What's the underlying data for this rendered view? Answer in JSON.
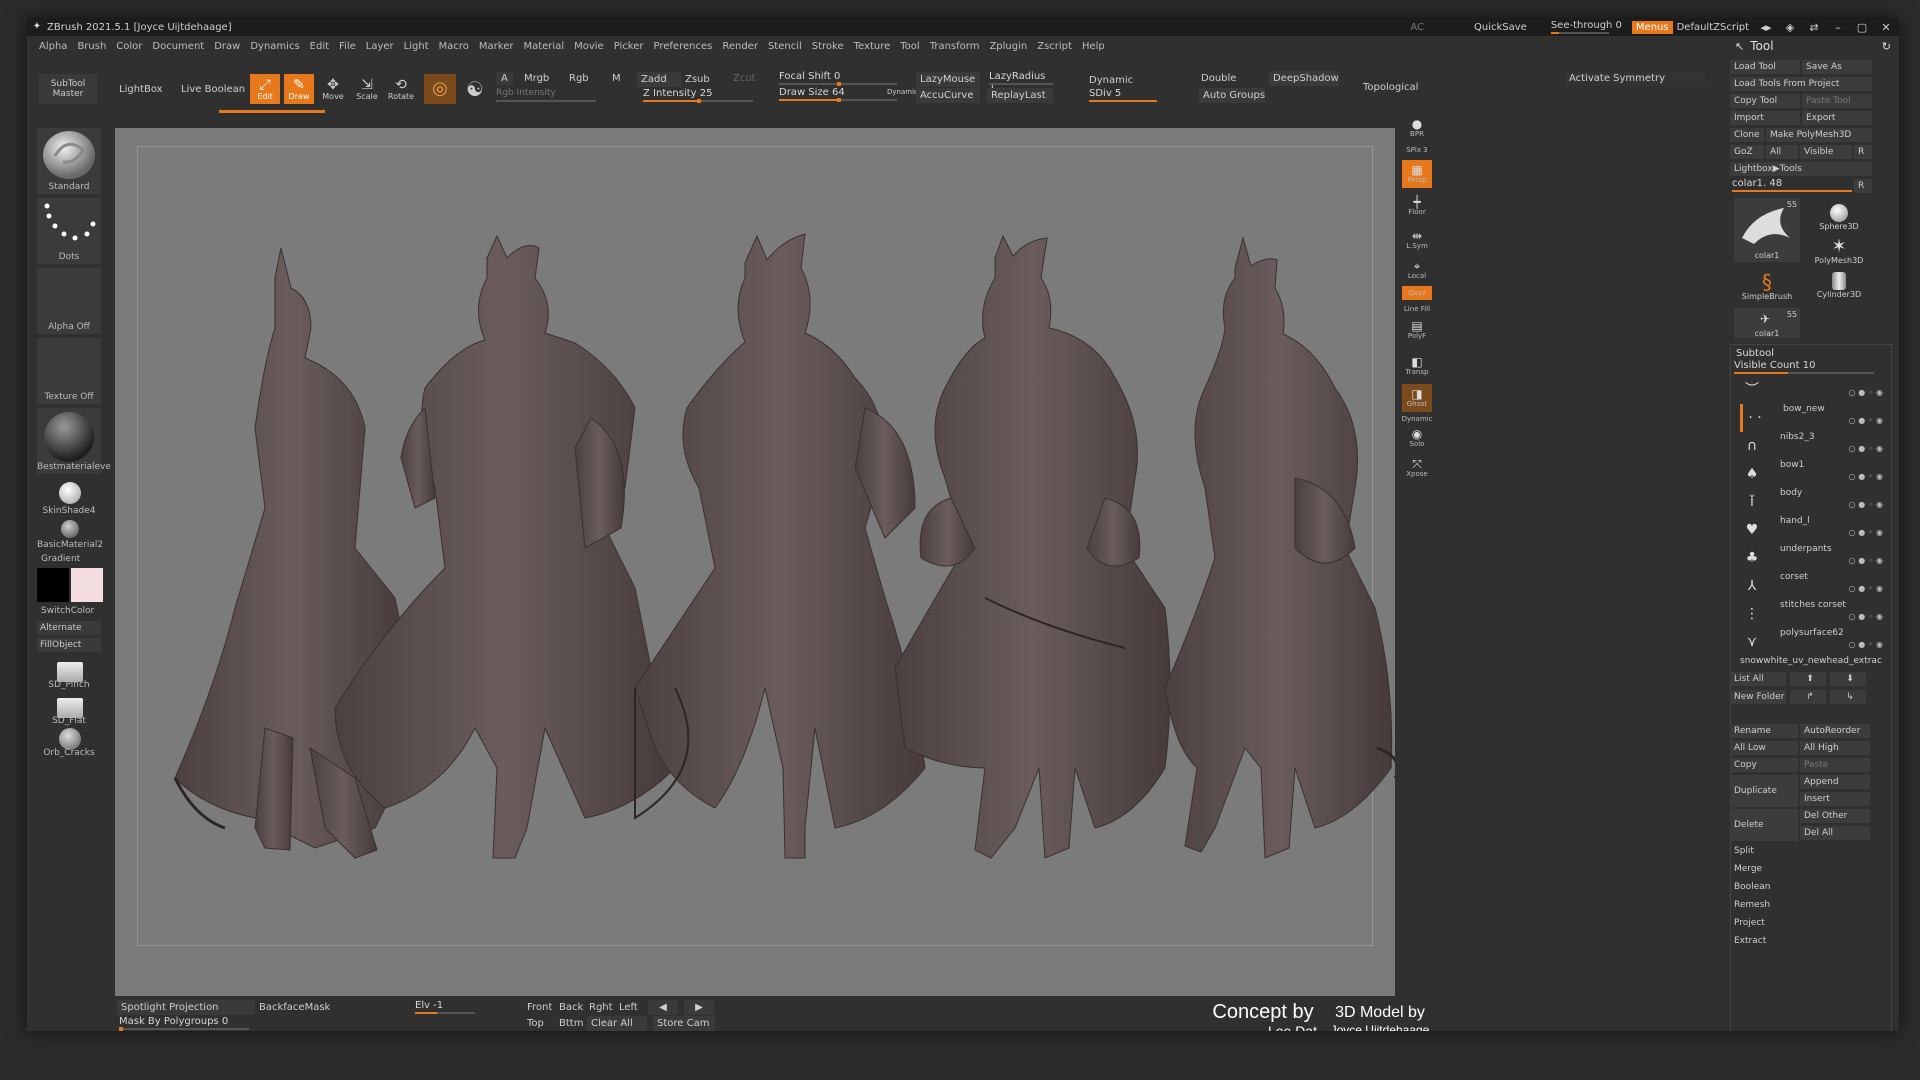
{
  "titlebar": {
    "title": "ZBrush 2021.5.1 [Joyce Uijtdehaage]",
    "ac": "AC",
    "quicksave": "QuickSave",
    "see_through": "See-through  0",
    "menus": "Menus",
    "default_zscript": "DefaultZScript"
  },
  "menubar": [
    "Alpha",
    "Brush",
    "Color",
    "Document",
    "Draw",
    "Dynamics",
    "Edit",
    "File",
    "Layer",
    "Light",
    "Macro",
    "Marker",
    "Material",
    "Movie",
    "Picker",
    "Preferences",
    "Render",
    "Stencil",
    "Stroke",
    "Texture",
    "Tool",
    "Transform",
    "Zplugin",
    "Zscript",
    "Help"
  ],
  "tool_header": "Tool",
  "shelf": {
    "subtool_master": "SubTool Master",
    "lightbox": "LightBox",
    "live_boolean": "Live Boolean",
    "edit": "Edit",
    "draw": "Draw",
    "move": "Move",
    "scale": "Scale",
    "rotate": "Rotate",
    "a": "A",
    "mrgb": "Mrgb",
    "rgb": "Rgb",
    "m": "M",
    "rgb_intensity": "Rgb Intensity",
    "zadd": "Zadd",
    "zsub": "Zsub",
    "zcut": "Zcut",
    "z_intensity": "Z Intensity 25",
    "focal_shift": "Focal Shift 0",
    "draw_size": "Draw Size 64",
    "dynamic_small": "Dynamic",
    "lazymouse": "LazyMouse",
    "lazyradius": "LazyRadius 1",
    "accucurve": "AccuCurve",
    "replaylast": "ReplayLast",
    "dynamic": "Dynamic",
    "sdiv": "SDiv 5",
    "double": "Double",
    "deepshadow": "DeepShadow",
    "auto_groups": "Auto Groups",
    "topological": "Topological",
    "activate_symmetry": "Activate Symmetry"
  },
  "left_shelf": {
    "standard": "Standard",
    "dots": "Dots",
    "alpha_off": "Alpha Off",
    "texture_off": "Texture Off",
    "bestmaterial": "Bestmaterialeve",
    "skinshade": "SkinShade4",
    "basicmaterial": "BasicMaterial2",
    "gradient": "Gradient",
    "switchcolor": "SwitchColor",
    "alternate": "Alternate",
    "fillobject": "FillObject",
    "sd_pinch": "SD_Pinch",
    "sd_flat": "SD_Flat",
    "orb_cracks": "Orb_Cracks"
  },
  "right_shelf": [
    "BPR",
    "SPix 3",
    "Persp",
    "Floor",
    "L.Sym",
    "Local",
    "Qxyz",
    "Line Fill",
    "PolyF",
    "Transp",
    "Ghost",
    "Dynamic",
    "Solo",
    "Xpose"
  ],
  "bottom": {
    "spotlight": "Spotlight Projection",
    "backface": "BackfaceMask",
    "mask_poly": "Mask By Polygroups 0",
    "elv": "Elv -1",
    "front": "Front",
    "back": "Back",
    "right": "Rght",
    "left": "Left",
    "top": "Top",
    "bottom": "Bttm",
    "clear_all": "Clear All",
    "store_cam": "Store Cam",
    "concept_by": "Concept by",
    "concept_name": "Lee Dat",
    "model_by": "3D Model by",
    "model_name": "Joyce Uijtdehaage"
  },
  "tool_panel": {
    "load_tool": "Load Tool",
    "save_as": "Save As",
    "load_from_project": "Load Tools From Project",
    "copy_tool": "Copy Tool",
    "paste_tool": "Paste Tool",
    "import": "Import",
    "export": "Export",
    "clone": "Clone",
    "make_polymesh": "Make PolyMesh3D",
    "goz": "GoZ",
    "all": "All",
    "visible": "Visible",
    "r": "R",
    "lightbox_tools": "Lightbox▶Tools",
    "current_tool": "colar1. 48",
    "thumb_colar1": "colar1",
    "thumb_count": "55",
    "sphere3d": "Sphere3D",
    "polymesh3d": "PolyMesh3D",
    "simplebrush": "SimpleBrush",
    "cylinder3d": "Cylinder3D",
    "colar1_small": "colar1",
    "subtool": "Subtool",
    "visible_count": "Visible Count 10",
    "subtools": [
      "bow_new",
      "nibs2_3",
      "bow1",
      "body",
      "hand_l",
      "underpants",
      "corset",
      "stitches corset",
      "polysurface62",
      "snowwhite_uv_newhead_extrac"
    ],
    "list_all": "List All",
    "new_folder": "New Folder",
    "rename": "Rename",
    "autoreorder": "AutoReorder",
    "all_low": "All Low",
    "all_high": "All High",
    "copy": "Copy",
    "paste": "Paste",
    "duplicate": "Duplicate",
    "append": "Append",
    "insert": "Insert",
    "delete": "Delete",
    "del_other": "Del Other",
    "del_all": "Del All",
    "split": "Split",
    "merge": "Merge",
    "boolean": "Boolean",
    "remesh": "Remesh",
    "project": "Project",
    "extract": "Extract"
  },
  "colors": {
    "accent": "#e8781c",
    "canvas": "#7b7b7b",
    "model": "#5a4d4d"
  }
}
